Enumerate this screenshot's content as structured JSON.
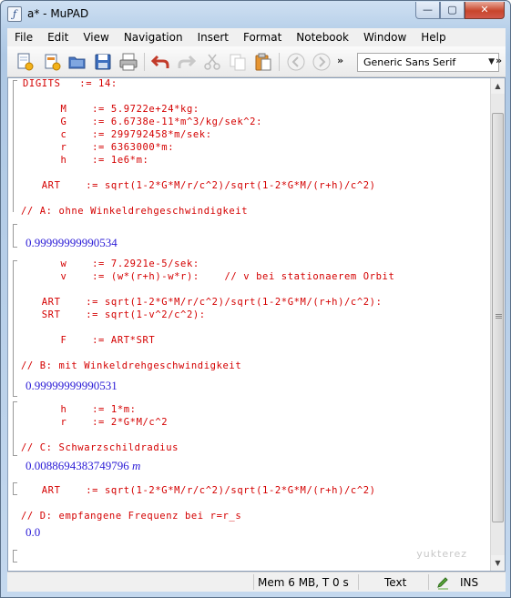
{
  "window": {
    "title": "a* - MuPAD",
    "buttons": {
      "minimize": "—",
      "maximize": "▢",
      "close": "✕"
    }
  },
  "menu": [
    "File",
    "Edit",
    "View",
    "Navigation",
    "Insert",
    "Format",
    "Notebook",
    "Window",
    "Help"
  ],
  "toolbar": {
    "icons": [
      "new-notebook-icon",
      "new-editor-icon",
      "open-icon",
      "save-icon",
      "print-icon",
      "undo-icon",
      "redo-icon",
      "cut-icon",
      "copy-icon",
      "paste-icon",
      "back-icon",
      "forward-icon"
    ],
    "overflow_left": "»",
    "overflow_right": "»",
    "font_name": "Generic Sans Serif",
    "font_dropdown_arrow": "▼"
  },
  "notebook": {
    "lines": [
      "DIGITS   := 14:",
      "      M    := 5.9722e+24*kg:",
      "      G    := 6.6738e-11*m^3/kg/sek^2:",
      "      c    := 299792458*m/sek:",
      "      r    := 6363000*m:",
      "      h    := 1e6*m:",
      "   ART    := sqrt(1-2*G*M/r/c^2)/sqrt(1-2*G*M/(r+h)/c^2)",
      "// A: ohne Winkeldrehgeschwindigkeit",
      "      w    := 7.2921e-5/sek:",
      "      v    := (w*(r+h)-w*r):    // v bei stationaerem Orbit",
      "   ART    := sqrt(1-2*G*M/r/c^2)/sqrt(1-2*G*M/(r+h)/c^2):",
      "   SRT    := sqrt(1-v^2/c^2):",
      "      F    := ART*SRT",
      "// B: mit Winkeldrehgeschwindigkeit",
      "      h    := 1*m:",
      "      r    := 2*G*M/c^2",
      "// C: Schwarzschildradius",
      "   ART    := sqrt(1-2*G*M/r/c^2)/sqrt(1-2*G*M/(r+h)/c^2)",
      "// D: empfangene Frequenz bei r=r_s"
    ],
    "results": {
      "a": "0.99999999990534",
      "b": "0.99999999990531",
      "c_value": "0.0088694383749796",
      "c_unit": "m",
      "d": "0.0"
    },
    "watermark": "yukterez"
  },
  "status": {
    "memory": "Mem 6 MB, T 0 s",
    "mode": "Text",
    "insert": "INS"
  },
  "colors": {
    "input_text": "#d40000",
    "result_text": "#2a1bd6"
  }
}
